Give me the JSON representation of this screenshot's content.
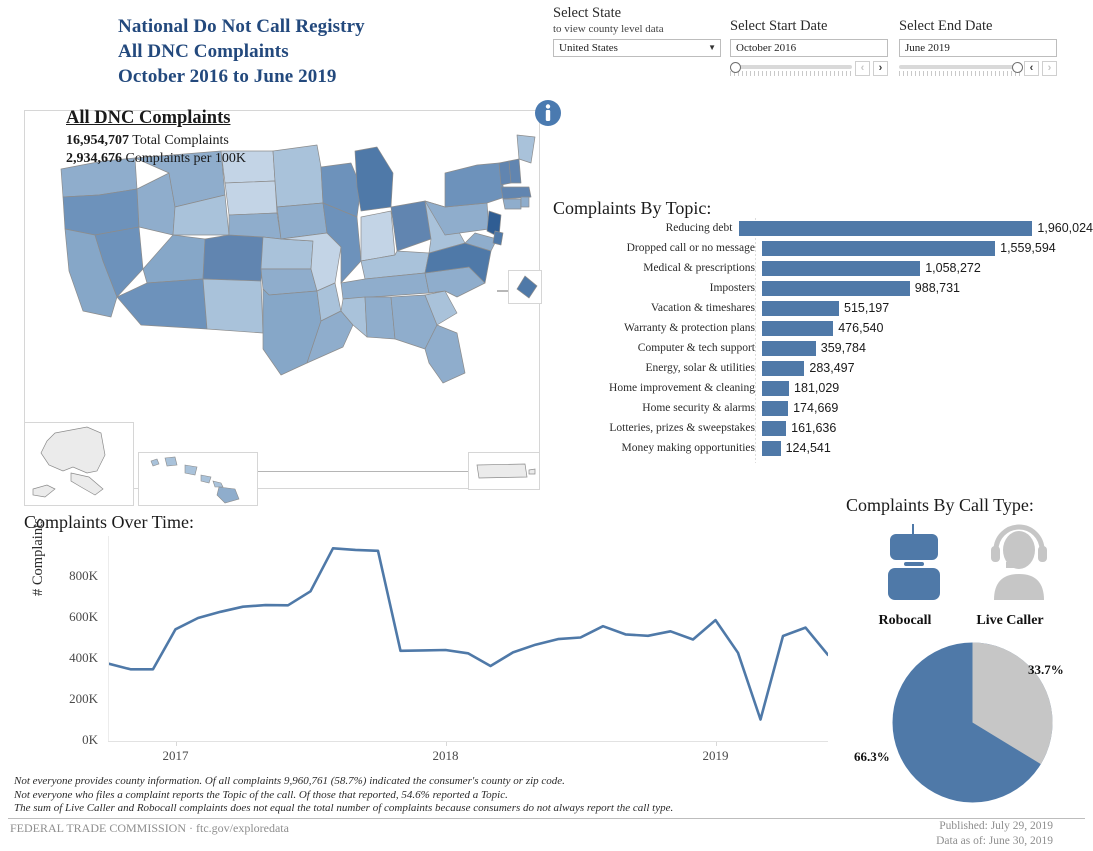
{
  "header": {
    "title_lines": [
      "National Do Not Call Registry",
      "All DNC Complaints",
      "October 2016 to June 2019"
    ],
    "title_color": "#23497d"
  },
  "controls": {
    "state": {
      "label": "Select State",
      "sublabel": "to view county level data",
      "value": "United States",
      "caret_icon": "chevron-down-icon"
    },
    "start_date": {
      "label": "Select Start Date",
      "value": "October 2016",
      "slider_position_pct": 0,
      "prev_icon": "chevron-left-icon",
      "next_icon": "chevron-right-icon"
    },
    "end_date": {
      "label": "Select End Date",
      "value": "June 2019",
      "slider_position_pct": 100,
      "prev_icon": "chevron-left-icon",
      "next_icon": "chevron-right-icon"
    }
  },
  "kpi": {
    "info_icon": "info-circle-icon",
    "title": "All DNC Complaints",
    "total_value": "16,954,707",
    "total_label": "Total Complaints",
    "per100k_value": "2,934,676",
    "per100k_label": "Complaints per 100K"
  },
  "map": {
    "heading": "",
    "callout_label": "DC",
    "no_data_color": "#ebebeb",
    "insets": [
      "Alaska",
      "Hawaii",
      "Puerto Rico"
    ]
  },
  "sections": {
    "topic_heading": "Complaints By Topic:",
    "time_heading": "Complaints Over Time:",
    "calltype_heading": "Complaints By Call Type:"
  },
  "calltype": {
    "robocall_label": "Robocall",
    "livecaller_label": "Live Caller",
    "robocall_icon": "robot-icon",
    "livecaller_icon": "headset-person-icon",
    "robocall_color": "#4f79a8",
    "livecaller_color": "#c6c6c6"
  },
  "footnotes": [
    "Not everyone provides county information.  Of all complaints 9,960,761 (58.7%) indicated the consumer's county or zip code.",
    "Not everyone who files a complaint reports the Topic of the call.  Of those that reported, 54.6% reported a Topic.",
    "The sum of Live Caller and Robocall complaints does not equal the total number of complaints because consumers do not always report the call type."
  ],
  "footer": {
    "agency": "FEDERAL TRADE COMMISSION · ftc.gov/exploredata",
    "published": "Published: July 29, 2019",
    "data_as_of": "Data as of: June 30, 2019"
  },
  "chart_data": [
    {
      "type": "bar",
      "title": "Complaints By Topic:",
      "orientation": "horizontal",
      "xlabel": "",
      "ylabel": "",
      "bar_color": "#4f79a8",
      "xlim": [
        0,
        1960024
      ],
      "categories": [
        "Reducing debt",
        "Dropped call or no message",
        "Medical & prescriptions",
        "Imposters",
        "Vacation & timeshares",
        "Warranty & protection plans",
        "Computer & tech support",
        "Energy, solar & utilities",
        "Home improvement & cleaning",
        "Home security & alarms",
        "Lotteries, prizes & sweepstakes",
        "Money making opportunities"
      ],
      "values": [
        1960024,
        1559594,
        1058272,
        988731,
        515197,
        476540,
        359784,
        283497,
        181029,
        174669,
        161636,
        124541
      ],
      "value_labels": [
        "1,960,024",
        "1,559,594",
        "1,058,272",
        "988,731",
        "515,197",
        "476,540",
        "359,784",
        "283,497",
        "181,029",
        "174,669",
        "161,636",
        "124,541"
      ]
    },
    {
      "type": "line",
      "title": "Complaints Over Time:",
      "xlabel": "",
      "ylabel": "# Complaints",
      "line_color": "#4f79a8",
      "ylim": [
        0,
        1000000
      ],
      "yticks": [
        0,
        200000,
        400000,
        600000,
        800000
      ],
      "ytick_labels": [
        "0K",
        "200K",
        "400K",
        "600K",
        "800K"
      ],
      "xticks": [
        "2017",
        "2018",
        "2019"
      ],
      "grid": false,
      "x": [
        "2016-10",
        "2016-11",
        "2016-12",
        "2017-01",
        "2017-02",
        "2017-03",
        "2017-04",
        "2017-05",
        "2017-06",
        "2017-07",
        "2017-08",
        "2017-09",
        "2017-10",
        "2017-11",
        "2017-12",
        "2018-01",
        "2018-02",
        "2018-03",
        "2018-04",
        "2018-05",
        "2018-06",
        "2018-07",
        "2018-08",
        "2018-09",
        "2018-10",
        "2018-11",
        "2018-12",
        "2019-01",
        "2019-02",
        "2019-03",
        "2019-04",
        "2019-05",
        "2019-06"
      ],
      "values": [
        378000,
        350000,
        350000,
        545000,
        600000,
        630000,
        655000,
        663000,
        662000,
        730000,
        940000,
        932000,
        928000,
        440000,
        442000,
        444000,
        428000,
        366000,
        432000,
        470000,
        497000,
        505000,
        560000,
        520000,
        513000,
        535000,
        495000,
        590000,
        430000,
        105000,
        512000,
        553000,
        420000
      ]
    },
    {
      "type": "pie",
      "title": "Complaints By Call Type:",
      "labels": [
        "Robocall",
        "Live Caller"
      ],
      "values": [
        66.3,
        33.7
      ],
      "value_labels": [
        "66.3%",
        "33.7%"
      ],
      "colors": [
        "#4f79a8",
        "#c6c6c6"
      ],
      "legend": "bottom"
    }
  ]
}
